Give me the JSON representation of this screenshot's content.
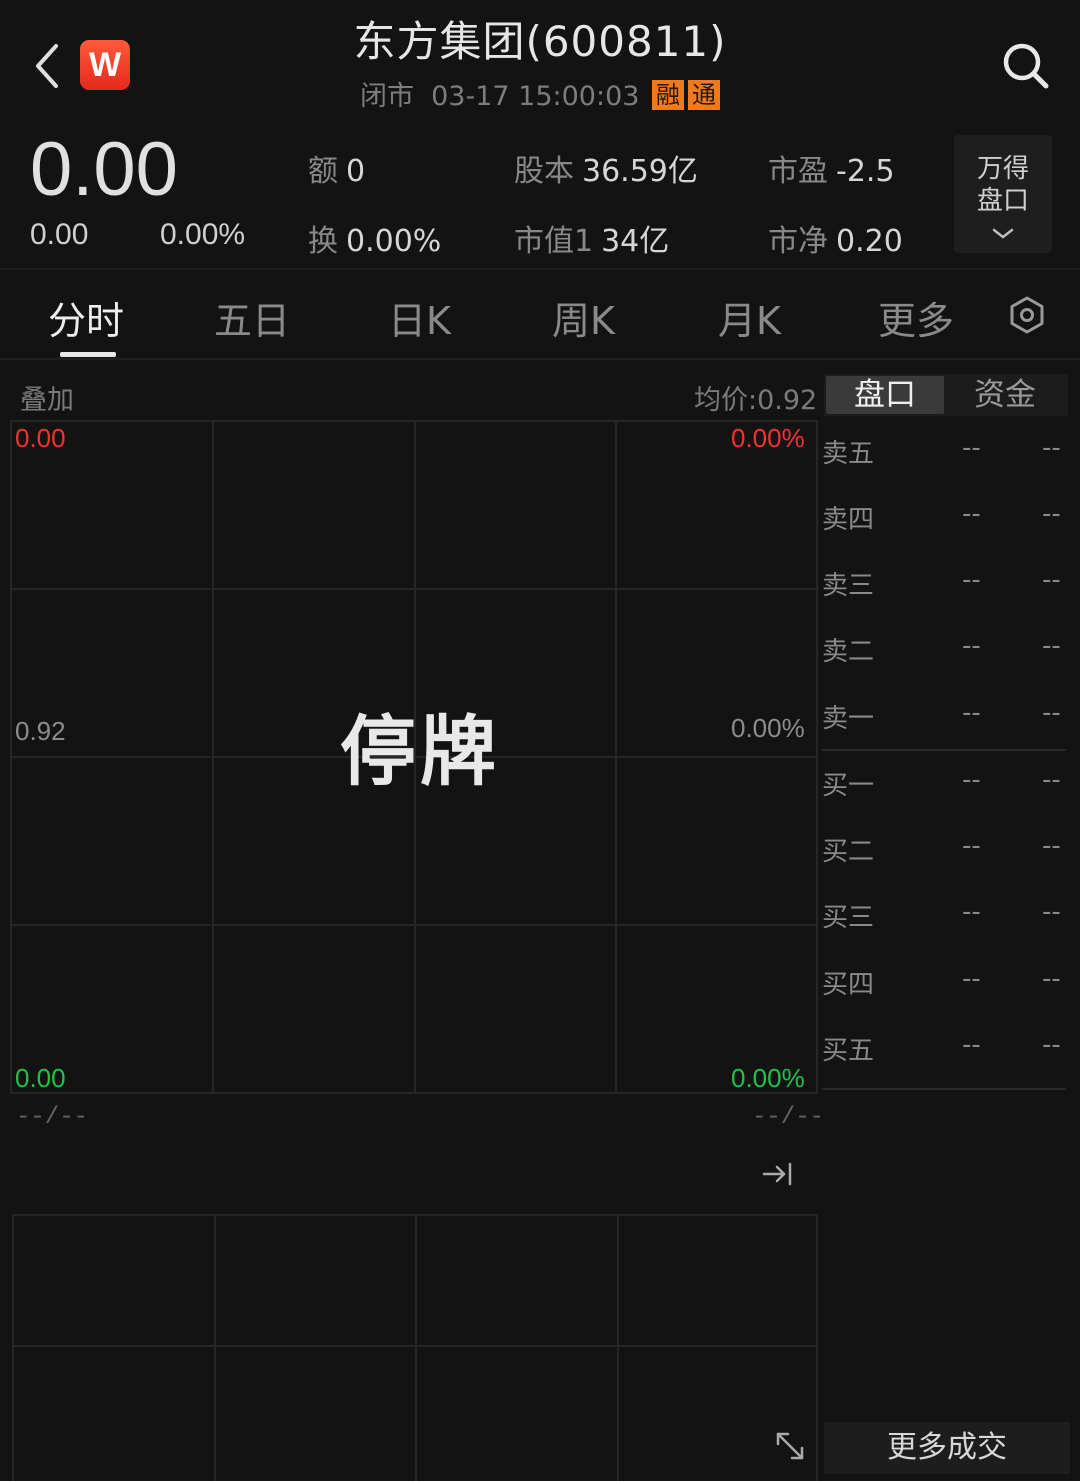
{
  "header": {
    "title": "东方集团(600811)",
    "status": "闭市",
    "datetime": "03-17 15:00:03",
    "badges": [
      "融",
      "通"
    ],
    "logo_letter": "W"
  },
  "quote": {
    "price": "0.00",
    "change": "0.00",
    "change_pct": "0.00%",
    "stats": [
      {
        "key": "额",
        "value": "0"
      },
      {
        "key": "换",
        "value": "0.00%"
      },
      {
        "key": "股本",
        "value": "36.59亿"
      },
      {
        "key": "市值1",
        "value": "34亿"
      },
      {
        "key": "市盈",
        "value": "-2.5"
      },
      {
        "key": "市净",
        "value": "0.20"
      }
    ],
    "wind_button": [
      "万得",
      "盘口"
    ]
  },
  "tabs": [
    "分时",
    "五日",
    "日K",
    "周K",
    "月K",
    "更多"
  ],
  "active_tab": "分时",
  "chart": {
    "overlay_label": "叠加",
    "avg_price_label": "均价:0.92",
    "left_axis": {
      "top": "0.00",
      "mid": "0.92",
      "bottom": "0.00"
    },
    "right_axis": {
      "top": "0.00%",
      "mid": "0.00%",
      "bottom": "0.00%"
    },
    "halt_text": "停牌",
    "time_start": "--/--",
    "time_end": "--/--"
  },
  "orderbook": {
    "tabs": [
      "盘口",
      "资金"
    ],
    "active_tab": "盘口",
    "sell": [
      {
        "label": "卖五",
        "price": "--",
        "vol": "--"
      },
      {
        "label": "卖四",
        "price": "--",
        "vol": "--"
      },
      {
        "label": "卖三",
        "price": "--",
        "vol": "--"
      },
      {
        "label": "卖二",
        "price": "--",
        "vol": "--"
      },
      {
        "label": "卖一",
        "price": "--",
        "vol": "--"
      }
    ],
    "buy": [
      {
        "label": "买一",
        "price": "--",
        "vol": "--"
      },
      {
        "label": "买二",
        "price": "--",
        "vol": "--"
      },
      {
        "label": "买三",
        "price": "--",
        "vol": "--"
      },
      {
        "label": "买四",
        "price": "--",
        "vol": "--"
      },
      {
        "label": "买五",
        "price": "--",
        "vol": "--"
      }
    ],
    "more_trades": "更多成交"
  },
  "colors": {
    "background": "#131313",
    "up": "#f03232",
    "down": "#1ec24a",
    "badge": "#f07a1c",
    "logo": "#e52a1c"
  }
}
